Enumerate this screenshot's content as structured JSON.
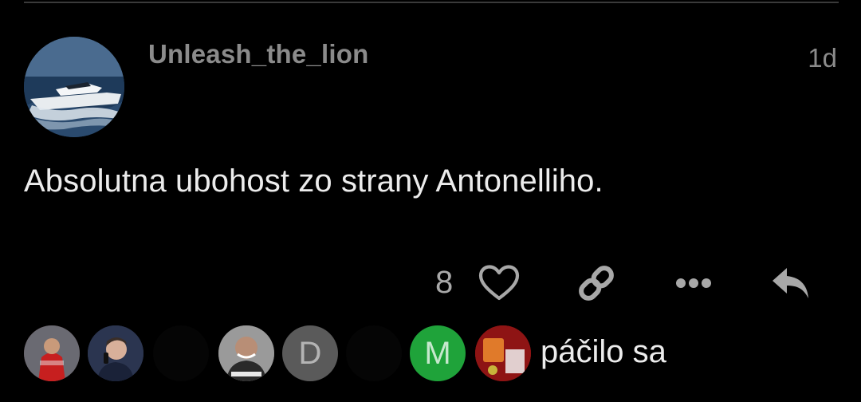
{
  "post": {
    "username": "Unleash_the_lion",
    "timestamp": "1d",
    "body": "Absolutna ubohost zo strany Antonelliho.",
    "like_count": "8"
  },
  "actions": [
    {
      "name": "like",
      "icon": "heart-icon"
    },
    {
      "name": "copy-link",
      "icon": "link-icon"
    },
    {
      "name": "more",
      "icon": "ellipsis-icon"
    },
    {
      "name": "reply",
      "icon": "reply-icon"
    }
  ],
  "likers": {
    "initials": [
      "D",
      "M"
    ],
    "label": "páčilo sa"
  },
  "colors": {
    "background": "#000000",
    "text": "#ececec",
    "muted": "#8b8b8b",
    "icon": "#a8a8a8",
    "green_avatar": "#1fa33a",
    "gray_avatar": "#5a5a5a"
  }
}
